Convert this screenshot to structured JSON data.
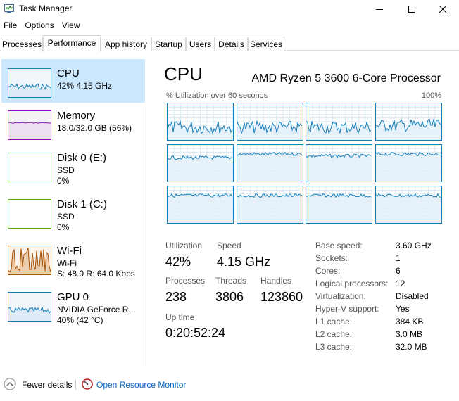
{
  "window": {
    "title": "Task Manager",
    "icon": "task-manager-icon",
    "controls": {
      "minimize": "minimize-icon",
      "maximize": "maximize-icon",
      "close": "close-icon"
    }
  },
  "menu": [
    "File",
    "Options",
    "View"
  ],
  "tabs": [
    "Processes",
    "Performance",
    "App history",
    "Startup",
    "Users",
    "Details",
    "Services"
  ],
  "active_tab": "Performance",
  "sidebar": [
    {
      "title": "CPU",
      "sub1": "42%  4.15 GHz",
      "sub2": "",
      "color": "#117dbb",
      "fill": "#f1f6fa"
    },
    {
      "title": "Memory",
      "sub1": "18.0/32.0 GB (56%)",
      "sub2": "",
      "color": "#8b12ae",
      "fill": "#f4f2f4"
    },
    {
      "title": "Disk 0 (E:)",
      "sub1": "SSD",
      "sub2": "0%",
      "color": "#4da60c",
      "fill": "#ffffff"
    },
    {
      "title": "Disk 1 (C:)",
      "sub1": "SSD",
      "sub2": "0%",
      "color": "#4da60c",
      "fill": "#ffffff"
    },
    {
      "title": "Wi-Fi",
      "sub1": "Wi-Fi",
      "sub2": "S: 48.0  R: 64.0 Kbps",
      "color": "#a74f01",
      "fill": "#fcf3eb"
    },
    {
      "title": "GPU 0",
      "sub1": "NVIDIA GeForce R...",
      "sub2": "40%  (42 °C)",
      "color": "#117dbb",
      "fill": "#f1f6fa"
    }
  ],
  "cpu": {
    "title": "CPU",
    "model": "AMD Ryzen 5 3600 6-Core Processor",
    "util_label": "% Utilization over 60 seconds",
    "util_max": "100%",
    "core_levels": [
      0.35,
      0.35,
      0.35,
      0.4,
      0.65,
      0.75,
      0.7,
      0.75,
      0.75,
      0.75,
      0.75,
      0.75
    ],
    "stats": {
      "utilization_label": "Utilization",
      "utilization": "42%",
      "speed_label": "Speed",
      "speed": "4.15 GHz",
      "processes_label": "Processes",
      "processes": "238",
      "threads_label": "Threads",
      "threads": "3806",
      "handles_label": "Handles",
      "handles": "123860",
      "uptime_label": "Up time",
      "uptime": "0:20:52:24"
    },
    "info": [
      {
        "label": "Base speed:",
        "value": "3.60 GHz"
      },
      {
        "label": "Sockets:",
        "value": "1"
      },
      {
        "label": "Cores:",
        "value": "6"
      },
      {
        "label": "Logical processors:",
        "value": "12"
      },
      {
        "label": "Virtualization:",
        "value": "Disabled"
      },
      {
        "label": "Hyper-V support:",
        "value": "Yes"
      },
      {
        "label": "L1 cache:",
        "value": "384 KB"
      },
      {
        "label": "L2 cache:",
        "value": "3.0 MB"
      },
      {
        "label": "L3 cache:",
        "value": "32.0 MB"
      }
    ]
  },
  "footer": {
    "fewer_details": "Fewer details",
    "open_monitor": "Open Resource Monitor"
  }
}
